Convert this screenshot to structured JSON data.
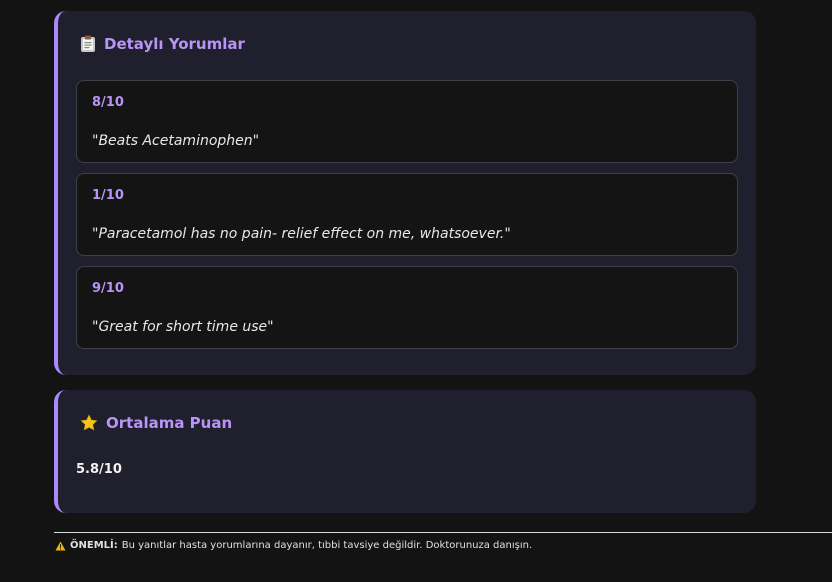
{
  "reviews_section": {
    "title": "Detaylı Yorumlar",
    "icon": "clipboard-icon",
    "items": [
      {
        "score": "8/10",
        "comment": "\"Beats Acetaminophen\""
      },
      {
        "score": "1/10",
        "comment": "\"Paracetamol has no pain- relief effect on me, whatsoever.\""
      },
      {
        "score": "9/10",
        "comment": "\"Great for short time use\""
      }
    ]
  },
  "average_section": {
    "title": "Ortalama Puan",
    "icon": "star-icon",
    "value": "5.8/10"
  },
  "notice": {
    "icon": "warning-icon",
    "label": "ÖNEMLİ:",
    "text": "Bu yanıtlar hasta yorumlarına dayanır, tıbbi tavsiye değildir. Doktorunuza danışın."
  },
  "colors": {
    "accent": "#a78bfa",
    "title": "#b794f6",
    "card_bg": "#201f2d",
    "page_bg": "#131313"
  }
}
